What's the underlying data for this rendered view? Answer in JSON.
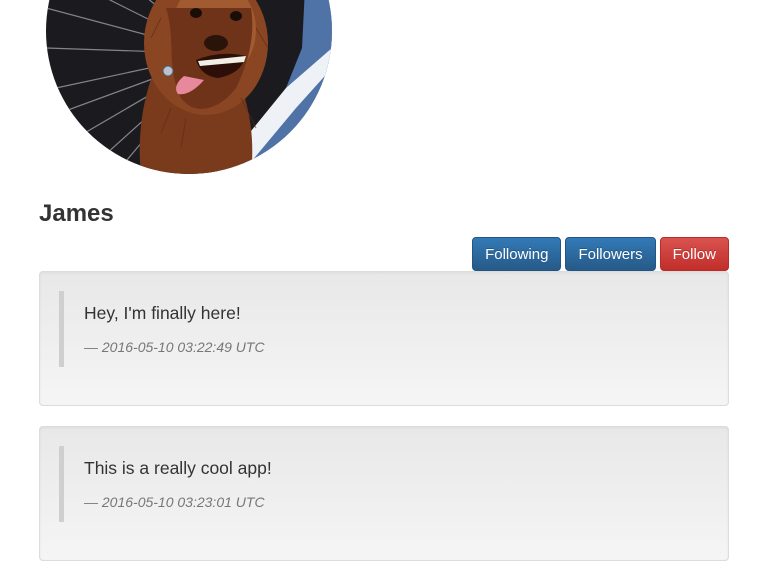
{
  "profile": {
    "username": "James",
    "avatar_icon": "chewbacca-avatar-icon"
  },
  "actions": {
    "following_label": "Following",
    "followers_label": "Followers",
    "follow_label": "Follow"
  },
  "posts": [
    {
      "text": "Hey, I'm finally here!",
      "timestamp": "— 2016-05-10 03:22:49 UTC"
    },
    {
      "text": "This is a really cool app!",
      "timestamp": "— 2016-05-10 03:23:01 UTC"
    }
  ],
  "colors": {
    "primary": "#337ab7",
    "danger": "#d9534f"
  }
}
